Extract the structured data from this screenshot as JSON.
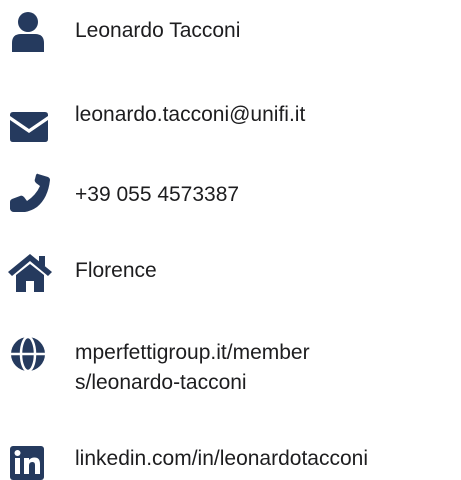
{
  "accent_color": "#253a5e",
  "contact": {
    "name": {
      "icon": "user-icon",
      "text": "Leonardo Tacconi"
    },
    "email": {
      "icon": "envelope-icon",
      "text": "leonardo.tacconi@unifi.it"
    },
    "phone": {
      "icon": "phone-icon",
      "text": "+39 055 4573387"
    },
    "location": {
      "icon": "home-icon",
      "text": "Florence"
    },
    "website": {
      "icon": "globe-icon",
      "text": "mperfettigroup.it/members/leonardo-tacconi"
    },
    "linkedin": {
      "icon": "linkedin-icon",
      "text": "linkedin.com/in/leonardotacconi"
    }
  }
}
